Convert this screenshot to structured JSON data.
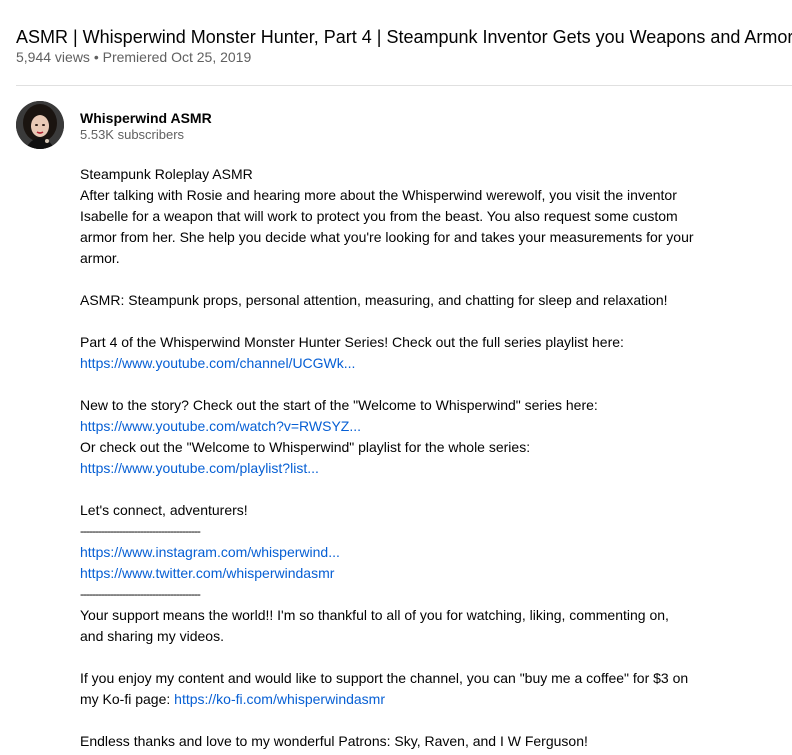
{
  "video": {
    "title": "ASMR | Whisperwind Monster Hunter, Part 4 | Steampunk Inventor Gets you Weapons and Armor",
    "stats": "5,944 views • Premiered Oct 25, 2019"
  },
  "channel": {
    "name": "Whisperwind ASMR",
    "subscribers": "5.53K subscribers"
  },
  "description": {
    "l1": "Steampunk Roleplay ASMR",
    "l2": "After talking with Rosie and hearing more about the Whisperwind werewolf, you visit the inventor",
    "l3": "Isabelle for a weapon that will work to protect you from the beast. You also request some custom",
    "l4": "armor from her. She help you decide what you're looking for and takes your measurements for your",
    "l5": "armor.",
    "l6": "ASMR: Steampunk props, personal attention, measuring, and chatting for sleep and relaxation!",
    "l7": "Part 4 of the Whisperwind Monster Hunter Series! Check out the full series playlist here:",
    "link_channel": "https://www.youtube.com/channel/UCGWk...",
    "l8": "New to the story? Check out the start of the \"Welcome to Whisperwind\" series here:",
    "link_watch": "https://www.youtube.com/watch?v=RWSYZ...",
    "l9": "Or check out the \"Welcome to Whisperwind\" playlist for the whole series:",
    "link_playlist": "https://www.youtube.com/playlist?list...",
    "l10": "Let's connect, adventurers!",
    "separator": "----------------------------------------",
    "link_instagram": "https://www.instagram.com/whisperwind...",
    "link_twitter": "https://www.twitter.com/whisperwindasmr",
    "l11": "Your support means the world!!  I'm so thankful to all of you for watching, liking, commenting on,",
    "l12": "and sharing my videos.",
    "l13": "If you enjoy my content and would like to support the channel, you can \"buy me a coffee\" for $3 on",
    "l14_prefix": "my Ko-fi page: ",
    "link_kofi": "https://ko-fi.com/whisperwindasmr",
    "l15": "Endless thanks and love to my wonderful Patrons: Sky, Raven, and I W Ferguson!"
  },
  "colors": {
    "link": "#065fd4",
    "secondary_text": "#606060",
    "primary_text": "#030303"
  }
}
